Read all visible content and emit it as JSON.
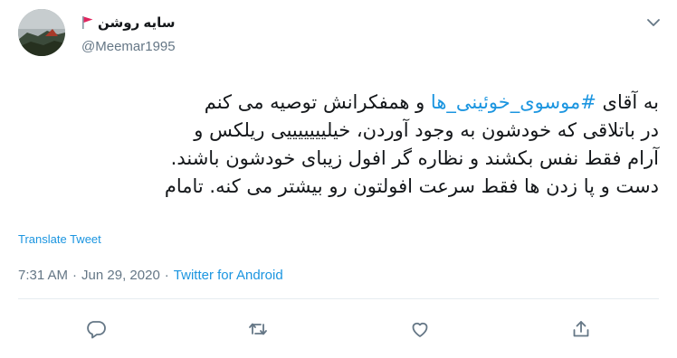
{
  "user": {
    "display_name": "سایه روشن",
    "handle": "@Meemar1995",
    "flag_icon": "triangular-flag-icon",
    "flag_color": "#e0245e"
  },
  "tweet": {
    "line1_prefix": "به آقای ",
    "hashtag": "#موسوی_خوئینی_ها",
    "line1_suffix": " و همفکرانش توصیه می کنم",
    "line2": "در باتلاقی که خودشون به وجود آوردن، خیلیییییییی ریلکس و",
    "line3": "آرام فقط نفس بکشند و نظاره گر افول زیبای خودشون باشند.",
    "line4": "دست و پا زدن ها فقط سرعت افولتون رو بیشتر می کنه. تامام"
  },
  "translate_label": "Translate Tweet",
  "meta": {
    "time": "7:31 AM",
    "separator": "·",
    "date": "Jun 29, 2020",
    "separator2": "·",
    "source": "Twitter for Android"
  },
  "colors": {
    "link": "#1b95e0",
    "secondary_text": "#657786",
    "divider": "#e6ecf0"
  },
  "actions": [
    "reply-icon",
    "retweet-icon",
    "like-icon",
    "share-icon"
  ]
}
